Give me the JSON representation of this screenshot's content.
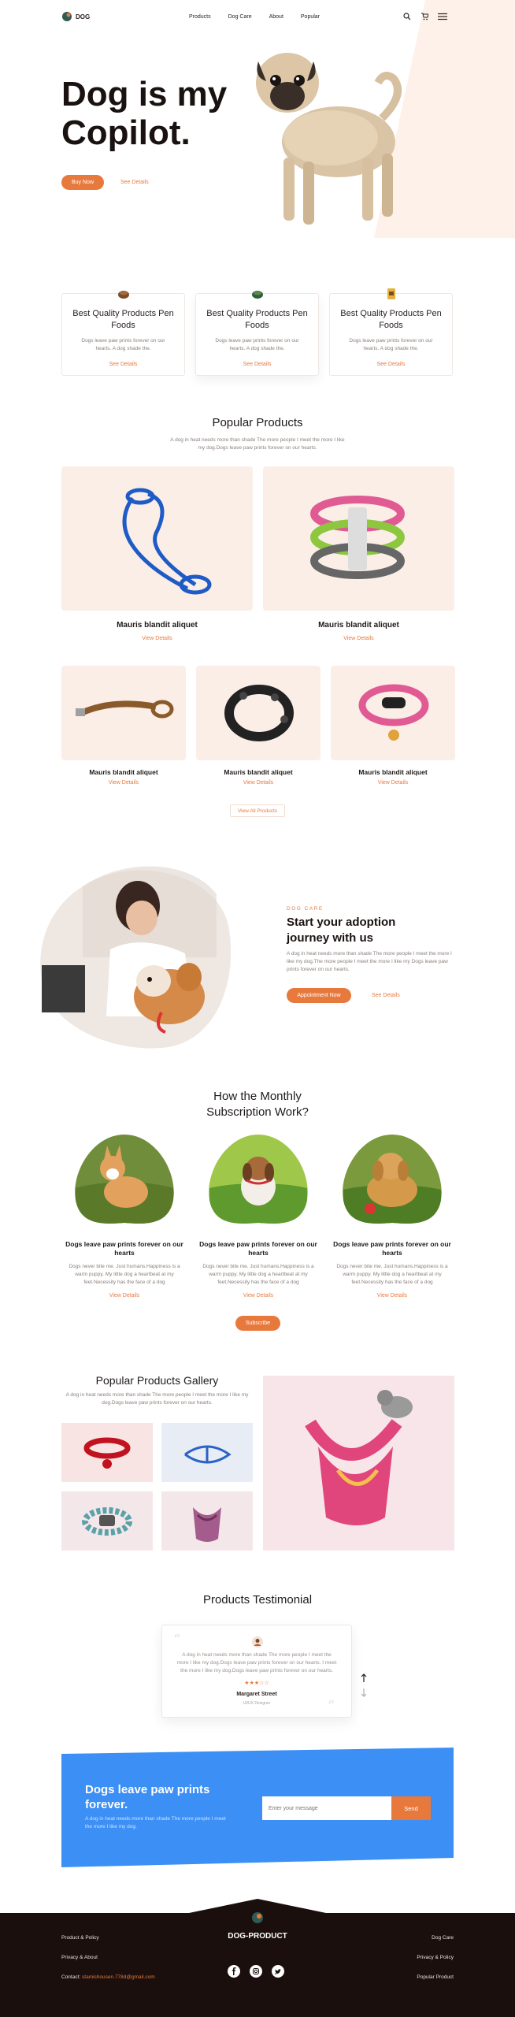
{
  "colors": {
    "accent": "#e8793d",
    "peach": "#fbeee7",
    "blue": "#3b8ff5",
    "footer": "#1a0f0c"
  },
  "header": {
    "logo_text": "DOG",
    "nav": [
      "Products",
      "Dog Care",
      "About",
      "Popular"
    ],
    "icons": [
      "search-icon",
      "cart-icon",
      "menu-icon"
    ]
  },
  "hero": {
    "title_line1": "Dog is my",
    "title_line2": "Copilot.",
    "primary_button": "Buy Now",
    "secondary_link": "See Details"
  },
  "features": [
    {
      "title": "Best Quality Products Pen Foods",
      "text": "Dogs leave paw prints forever on our hearts. A dog shade the.",
      "link": "See Details"
    },
    {
      "title": "Best Quality Products Pen Foods",
      "text": "Dogs leave paw prints forever on our hearts. A dog shade the.",
      "link": "See Details"
    },
    {
      "title": "Best Quality Products Pen Foods",
      "text": "Dogs leave paw prints forever on our hearts. A dog shade the.",
      "link": "See Details"
    }
  ],
  "popular": {
    "title": "Popular Products",
    "subtitle": "A dog in heat needs more than shade The more people I meet the more I like my dog.Dogs leave paw prints forever on our hearts.",
    "large_items": [
      {
        "name": "Mauris blandit aliquet",
        "link": "View Details"
      },
      {
        "name": "Mauris blandit aliquet",
        "link": "View Details"
      }
    ],
    "small_items": [
      {
        "name": "Mauris blandit aliquet",
        "link": "View Details"
      },
      {
        "name": "Mauris blandit aliquet",
        "link": "View Details"
      },
      {
        "name": "Mauris blandit aliquet",
        "link": "View Details"
      }
    ],
    "view_all": "View All Products"
  },
  "adoption": {
    "eyebrow": "DOG CARE",
    "title": "Start your adoption journey with us",
    "text": "A dog in heat needs more than shade The more people I meet the more I like my dog.The more people I meet the more I like my Dogs leave paw prints forever on our hearts.",
    "primary_button": "Appointment Now",
    "secondary_link": "See Details"
  },
  "subscription": {
    "title_line1": "How the Monthly",
    "title_line2": "Subscription Work?",
    "items": [
      {
        "title": "Dogs leave paw prints forever on our hearts",
        "text": "Dogs never bite me. Just humans.Happiness is a warm puppy. My little dog a heartbeat at my feet.Necessity has the face of a dog",
        "link": "View Details"
      },
      {
        "title": "Dogs leave paw prints forever on our hearts",
        "text": "Dogs never bite me. Just humans.Happiness is a warm puppy. My little dog a heartbeat at my feet.Necessity has the face of a dog",
        "link": "View Details"
      },
      {
        "title": "Dogs leave paw prints forever on our hearts",
        "text": "Dogs never bite me. Just humans.Happiness is a warm puppy. My little dog a heartbeat at my feet.Necessity has the face of a dog",
        "link": "View Details"
      }
    ],
    "button": "Subscribe"
  },
  "gallery": {
    "title": "Popular Products Gallery",
    "subtitle": "A dog in heat needs more than shade The more people I meet the more I like my dog.Dogs leave paw prints forever on our hearts."
  },
  "testimonial": {
    "title": "Products Testimonial",
    "quote": "A dog in heat needs more than shade The more people I meet the more I like my dog.Dogs leave paw prints forever on our hearts. I meet the more I like my dog.Dogs leave paw prints forever on our hearts.",
    "stars": "★★★☆☆",
    "name": "Margaret Street",
    "role": "UI/UX Designer"
  },
  "newsletter": {
    "title_line1": "Dogs leave paw prints",
    "title_line2": "forever.",
    "text": "A dog in heat needs more than shade The more people I meet the more I like my dog.",
    "placeholder": "Enter your message",
    "button": "Send"
  },
  "footer": {
    "brand": "DOG-PRODUCT",
    "left_links": [
      "Product & Policy",
      "Privacy & About"
    ],
    "contact_label": "Contact:",
    "contact_email": "stamishousen.778d@gmail.com",
    "right_links": [
      "Dog Care",
      "Privacy & Policy",
      "Popular Product"
    ],
    "social": [
      "facebook-icon",
      "instagram-icon",
      "twitter-icon"
    ]
  }
}
